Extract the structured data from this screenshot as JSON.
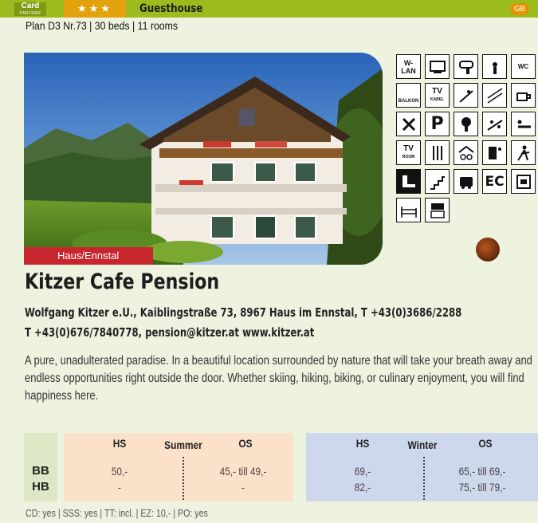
{
  "header": {
    "card_label": "Card",
    "card_sub": "PARTNER",
    "stars": "★★★",
    "category": "Guesthouse",
    "language": "GB"
  },
  "plan_line": "Plan D3 Nr.73 | 30 beds | 11 rooms",
  "location": "Haus/Ennstal",
  "title": "Kitzer Cafe Pension",
  "address_line1": "Wolfgang Kitzer e.U., Kaiblingstraße 73, 8967 Haus im Ennstal, T +43(0)3686/2288",
  "address_line2": "T +43(0)676/7840778, pension@kitzer.at www.kitzer.at",
  "description": "A pure, unadulterated paradise. In a beautiful location surrounded by nature that will take your breath away and endless opportunities right outside the door. Whether skiing, hiking, biking, or culinary enjoyment, you will find happiness here.",
  "amenities": {
    "wlan": "W-LAN",
    "balkon": "BALKON",
    "tv_kabel_tv": "TV",
    "tv_kabel_sub": "KABEL",
    "parking": "P",
    "tv_room_tv": "TV",
    "tv_room_sub": "ROOM",
    "ec": "EC",
    "wc": "WC"
  },
  "prices": {
    "summer": {
      "label": "Summer",
      "hs": "HS",
      "os": "OS"
    },
    "winter": {
      "label": "Winter",
      "hs": "HS",
      "os": "OS"
    },
    "rows": [
      {
        "label": "BB",
        "summer_hs": "50,-",
        "summer_os": "45,- till 49,-",
        "winter_hs": "69,-",
        "winter_os": "65,- till 69,-"
      },
      {
        "label": "HB",
        "summer_hs": "-",
        "summer_os": "-",
        "winter_hs": "82,-",
        "winter_os": "75,- till 79,-"
      }
    ]
  },
  "footer": "CD: yes | SSS: yes | TT: incl. | EZ: 10,- | PO: yes",
  "colors": {
    "accent_green": "#9cbb1e",
    "star_orange": "#e2a20c",
    "location_red": "#c8262f",
    "summer_bg": "#fbe1c9",
    "winter_bg": "#cdd8ec"
  }
}
